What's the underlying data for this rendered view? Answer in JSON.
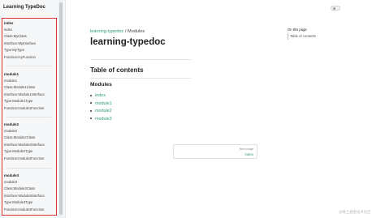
{
  "sidebar": {
    "title": "Learning TypeDoc",
    "groups": [
      {
        "title": "index",
        "items": [
          "index",
          "Class:MyClass",
          "Interface:MyInterface",
          "Type:MyType",
          "Function:myFunction"
        ]
      },
      {
        "title": "module1",
        "items": [
          "module1",
          "Class:Module1Class",
          "Interface:Module1Interface",
          "Type:Module1Type",
          "Function:module1Function"
        ]
      },
      {
        "title": "module2",
        "items": [
          "module2",
          "Class:Module2Class",
          "Interface:Module2Interface",
          "Type:Module2Type",
          "Function:module2Function"
        ]
      },
      {
        "title": "module3",
        "items": [
          "module3",
          "Class:Module3Class",
          "Interface:Module3Interface",
          "Type:Module3Type",
          "Function:module3Function"
        ]
      }
    ]
  },
  "header": {
    "theme_toggle_icon": "theme-toggle-icon"
  },
  "main": {
    "breadcrumb": {
      "link": "learning-typedoc",
      "separator": "/",
      "current": "Modules"
    },
    "title": "learning-typedoc",
    "toc_heading": "Table of contents",
    "modules_heading": "Modules",
    "modules": [
      "index",
      "module1",
      "module2",
      "module3"
    ],
    "next_page": {
      "label": "Next page",
      "link": "index"
    }
  },
  "right_toc": {
    "title": "On this page",
    "items": [
      "Table of contents"
    ]
  },
  "watermark": "@稀土掘金技术社区",
  "colors": {
    "accent": "#2f9c6d",
    "highlight_border": "#e0312b",
    "sidebar_bg": "#f6f7f8"
  }
}
